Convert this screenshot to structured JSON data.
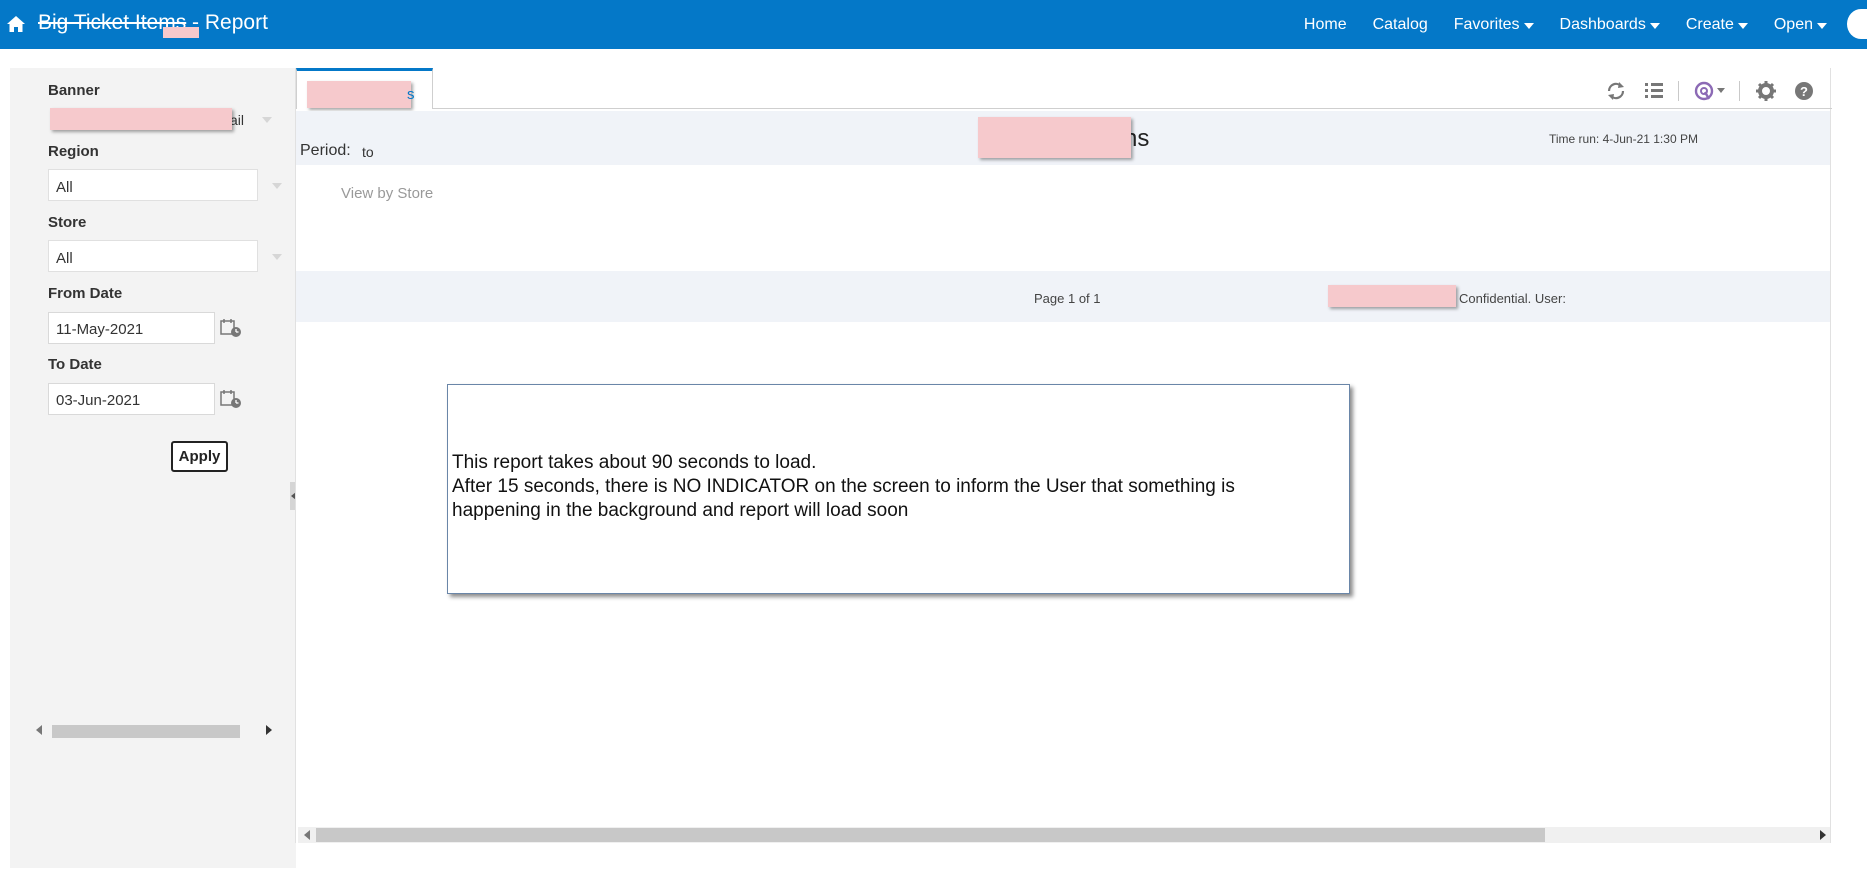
{
  "header": {
    "title_masked": "Big Ticket Items",
    "title_suffix": " - Report",
    "nav": [
      {
        "label": "Home",
        "dropdown": false
      },
      {
        "label": "Catalog",
        "dropdown": false
      },
      {
        "label": "Favorites",
        "dropdown": true
      },
      {
        "label": "Dashboards",
        "dropdown": true
      },
      {
        "label": "Create",
        "dropdown": true
      },
      {
        "label": "Open",
        "dropdown": true
      }
    ],
    "icons": {
      "home": "home-icon",
      "user": "user-icon"
    }
  },
  "prompts": {
    "banner": {
      "label": "Banner",
      "value_tail": "ail"
    },
    "region": {
      "label": "Region",
      "value": "All"
    },
    "store": {
      "label": "Store",
      "value": "All"
    },
    "from_date": {
      "label": "From Date",
      "value": "11-May-2021"
    },
    "to_date": {
      "label": "To Date",
      "value": "03-Jun-2021"
    },
    "apply_label": "Apply"
  },
  "report": {
    "tab_tail": "s",
    "toolbar_icons": [
      "refresh-icon",
      "list-icon",
      "analyze-icon",
      "settings-icon",
      "help-icon"
    ],
    "period_label": "Period:",
    "period_to": "to",
    "title_tail": "ns",
    "time_run": "Time run: 4-Jun-21 1:30 PM",
    "view_by": "View by Store",
    "page_info": "Page 1 of 1",
    "confidential": "Confidential. User:"
  },
  "annotation": {
    "line1": "This report takes about 90 seconds to load.",
    "line2": "After 15 seconds, there is NO INDICATOR on the screen to inform the User that something is",
    "line3": "happening in the background and report will load soon"
  },
  "colors": {
    "header_bg": "#0478c8",
    "redaction": "#f6c9cc",
    "band_bg": "#f0f3f8"
  }
}
